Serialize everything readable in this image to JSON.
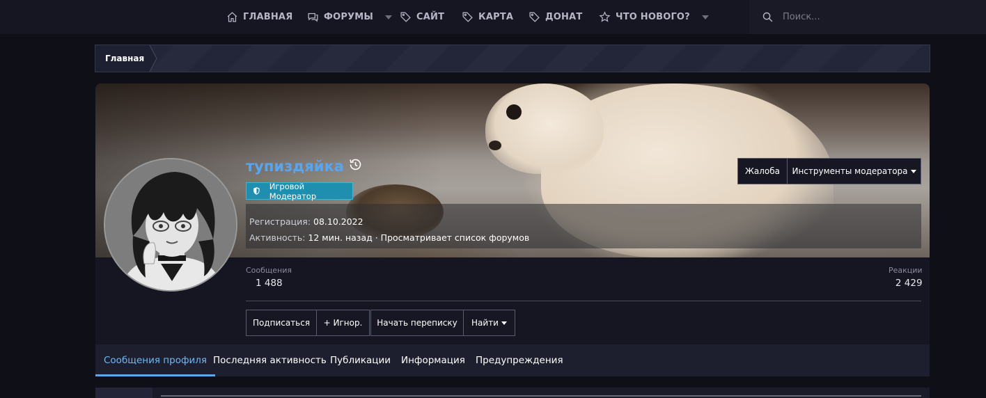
{
  "nav": {
    "items": [
      {
        "label": "ГЛАВНАЯ",
        "icon": "home-icon",
        "dropdown": false
      },
      {
        "label": "ФОРУМЫ",
        "icon": "chat-icon",
        "dropdown": true
      },
      {
        "label": "САЙТ",
        "icon": "tag-icon",
        "dropdown": false
      },
      {
        "label": "КАРТА",
        "icon": "tag-icon",
        "dropdown": false
      },
      {
        "label": "ДОНАТ",
        "icon": "tag-icon",
        "dropdown": false
      },
      {
        "label": "ЧТО НОВОГО?",
        "icon": "star-icon",
        "dropdown": true
      }
    ],
    "search_placeholder": "Поиск..."
  },
  "breadcrumb": {
    "items": [
      "Главная"
    ]
  },
  "profile": {
    "username": "тупиздяйка",
    "username_color": "#58a6f0",
    "role": "Игровой Модератор",
    "role_color": "#1f8fb0",
    "registration_label": "Регистрация:",
    "registration_value": "08.10.2022",
    "activity_label": "Активность:",
    "activity_value": "12 мин. назад · Просматривает список форумов",
    "report_button": "Жалоба",
    "moderator_tools_button": "Инструменты модератора",
    "stats": {
      "messages_label": "Сообщения",
      "messages_value": "1 488",
      "reactions_label": "Реакции",
      "reactions_value": "2 429"
    },
    "actions": {
      "follow": "Подписаться",
      "ignore": "+ Игнор.",
      "start_conversation": "Начать переписку",
      "find": "Найти"
    }
  },
  "tabs": [
    {
      "label": "Сообщения профиля",
      "active": true
    },
    {
      "label": "Последняя активность",
      "active": false
    },
    {
      "label": "Публикации",
      "active": false
    },
    {
      "label": "Информация",
      "active": false
    },
    {
      "label": "Предупреждения",
      "active": false
    }
  ],
  "colors": {
    "accent": "#5aa9ee",
    "background": "#0f0f18",
    "panel": "#161622"
  }
}
